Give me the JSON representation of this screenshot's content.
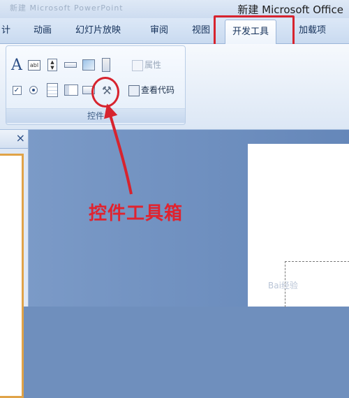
{
  "window": {
    "title_faded": "新建 Microsoft PowerPoint",
    "title": "新建 Microsoft Office"
  },
  "tabs": [
    {
      "label": "计"
    },
    {
      "label": "动画"
    },
    {
      "label": "幻灯片放映"
    },
    {
      "label": "审阅"
    },
    {
      "label": "视图"
    },
    {
      "label": "开发工具",
      "active": true
    },
    {
      "label": "加载项"
    }
  ],
  "ribbon": {
    "group_label": "控件",
    "font_control_glyph": "A",
    "textbox_glyph": "abl",
    "properties_label": "属性",
    "view_code_label": "查看代码",
    "checkbox_glyph": "✓"
  },
  "left_pane": {
    "close_glyph": "×"
  },
  "annotation": {
    "label": "控件工具箱",
    "color": "#d7232e"
  },
  "watermark": "Bai经验"
}
